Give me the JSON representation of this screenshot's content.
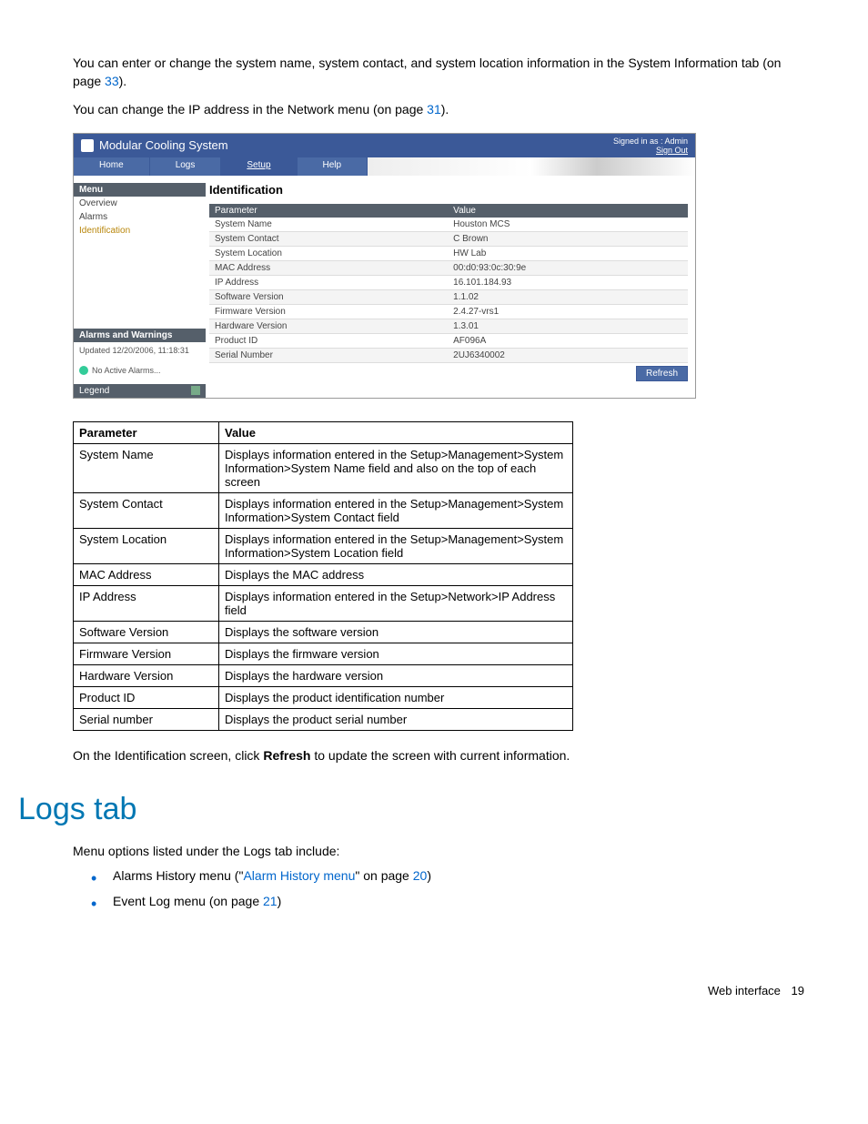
{
  "intro": {
    "p1a": "You can enter or change the system name, system contact, and system location information in the System Information tab (on page ",
    "p1link": "33",
    "p1b": ").",
    "p2a": "You can change the IP address in the Network menu (on page ",
    "p2link": "31",
    "p2b": ")."
  },
  "screenshot": {
    "title": "Modular Cooling System",
    "signed_in": "Signed in as : Admin",
    "sign_out": "Sign Out",
    "tabs": [
      "Home",
      "Logs",
      "Setup",
      "Help"
    ],
    "menu_header": "Menu",
    "menu_items": [
      "Overview",
      "Alarms",
      "Identification"
    ],
    "alarms_header": "Alarms and Warnings",
    "alarms_updated": "Updated 12/20/2006, 11:18:31",
    "no_active": "No Active Alarms...",
    "legend": "Legend",
    "heading": "Identification",
    "th_param": "Parameter",
    "th_value": "Value",
    "rows": [
      {
        "param": "System Name",
        "value": "Houston MCS"
      },
      {
        "param": "System Contact",
        "value": "C Brown"
      },
      {
        "param": "System Location",
        "value": "HW Lab"
      },
      {
        "param": "MAC Address",
        "value": "00:d0:93:0c:30:9e"
      },
      {
        "param": "IP Address",
        "value": "16.101.184.93"
      },
      {
        "param": "Software Version",
        "value": "1.1.02"
      },
      {
        "param": "Firmware Version",
        "value": "2.4.27-vrs1"
      },
      {
        "param": "Hardware Version",
        "value": "1.3.01"
      },
      {
        "param": "Product ID",
        "value": "AF096A"
      },
      {
        "param": "Serial Number",
        "value": "2UJ6340002"
      }
    ],
    "refresh": "Refresh"
  },
  "param_table": {
    "th_param": "Parameter",
    "th_value": "Value",
    "rows": [
      {
        "param": "System Name",
        "value": "Displays information entered in the Setup>Management>System Information>System Name field and also on the top of each screen"
      },
      {
        "param": "System Contact",
        "value": "Displays information entered in the Setup>Management>System Information>System Contact field"
      },
      {
        "param": "System Location",
        "value": "Displays information entered in the Setup>Management>System Information>System Location field"
      },
      {
        "param": "MAC Address",
        "value": "Displays the MAC address"
      },
      {
        "param": "IP Address",
        "value": "Displays information entered in the Setup>Network>IP Address field"
      },
      {
        "param": "Software Version",
        "value": "Displays the software version"
      },
      {
        "param": "Firmware Version",
        "value": "Displays the firmware version"
      },
      {
        "param": "Hardware Version",
        "value": "Displays the hardware version"
      },
      {
        "param": "Product ID",
        "value": "Displays the product identification number"
      },
      {
        "param": "Serial number",
        "value": "Displays the product serial number"
      }
    ]
  },
  "after_table": {
    "a": "On the Identification screen, click ",
    "bold": "Refresh",
    "b": " to update the screen with current information."
  },
  "logs": {
    "title": "Logs tab",
    "intro": "Menu options listed under the Logs tab include:",
    "b1a": "Alarms History menu (\"",
    "b1link": "Alarm History menu",
    "b1b": "\" on page ",
    "b1page": "20",
    "b1c": ")",
    "b2a": "Event Log menu (on page ",
    "b2page": "21",
    "b2b": ")"
  },
  "footer": {
    "label": "Web interface",
    "page": "19"
  }
}
